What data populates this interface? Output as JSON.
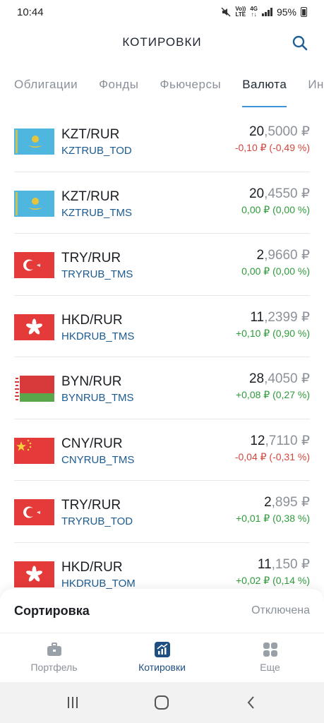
{
  "status_bar": {
    "time": "10:44",
    "volte_line1": "Vo))",
    "volte_line2": "LTE",
    "net_line1": "4G",
    "battery": "95%"
  },
  "header": {
    "title": "КОТИРОВКИ"
  },
  "tabs": [
    {
      "label": "Облигации",
      "active": false
    },
    {
      "label": "Фонды",
      "active": false
    },
    {
      "label": "Фьючерсы",
      "active": false
    },
    {
      "label": "Валюта",
      "active": true
    },
    {
      "label": "Ин",
      "active": false
    }
  ],
  "rows": [
    {
      "flag": "kazakhstan-flag",
      "pair": "KZT/RUR",
      "ticker": "KZTRUB_TOD",
      "price_int": "20",
      "price_frac": ",5000 ₽",
      "change": "-0,10 ₽ (-0,49 %)",
      "trend": "neg"
    },
    {
      "flag": "kazakhstan-flag",
      "pair": "KZT/RUR",
      "ticker": "KZTRUB_TMS",
      "price_int": "20",
      "price_frac": ",4550 ₽",
      "change": "0,00 ₽ (0,00 %)",
      "trend": "zero"
    },
    {
      "flag": "turkey-flag",
      "pair": "TRY/RUR",
      "ticker": "TRYRUB_TMS",
      "price_int": "2",
      "price_frac": ",9660 ₽",
      "change": "0,00 ₽ (0,00 %)",
      "trend": "zero"
    },
    {
      "flag": "hongkong-flag",
      "pair": "HKD/RUR",
      "ticker": "HKDRUB_TMS",
      "price_int": "11",
      "price_frac": ",2399 ₽",
      "change": "+0,10 ₽ (0,90 %)",
      "trend": "pos"
    },
    {
      "flag": "belarus-flag",
      "pair": "BYN/RUR",
      "ticker": "BYNRUB_TMS",
      "price_int": "28",
      "price_frac": ",4050 ₽",
      "change": "+0,08 ₽ (0,27 %)",
      "trend": "pos"
    },
    {
      "flag": "china-flag",
      "pair": "CNY/RUR",
      "ticker": "CNYRUB_TMS",
      "price_int": "12",
      "price_frac": ",7110 ₽",
      "change": "-0,04 ₽ (-0,31 %)",
      "trend": "neg"
    },
    {
      "flag": "turkey-flag",
      "pair": "TRY/RUR",
      "ticker": "TRYRUB_TOD",
      "price_int": "2",
      "price_frac": ",895 ₽",
      "change": "+0,01 ₽ (0,38 %)",
      "trend": "pos"
    },
    {
      "flag": "hongkong-flag",
      "pair": "HKD/RUR",
      "ticker": "HKDRUB_TOM",
      "price_int": "11",
      "price_frac": ",150 ₽",
      "change": "+0,02 ₽ (0,14 %)",
      "trend": "pos"
    }
  ],
  "sort": {
    "label": "Сортировка",
    "value": "Отключена"
  },
  "bottom_nav": [
    {
      "label": "Портфель",
      "icon": "briefcase-icon",
      "active": false
    },
    {
      "label": "Котировки",
      "icon": "chart-icon",
      "active": true
    },
    {
      "label": "Еще",
      "icon": "grid-icon",
      "active": false
    }
  ],
  "colors": {
    "accent": "#3d93d6",
    "active_nav": "#1f4e80",
    "ticker": "#1c5b90",
    "negative": "#d1473c",
    "positive": "#2e9b3a"
  }
}
